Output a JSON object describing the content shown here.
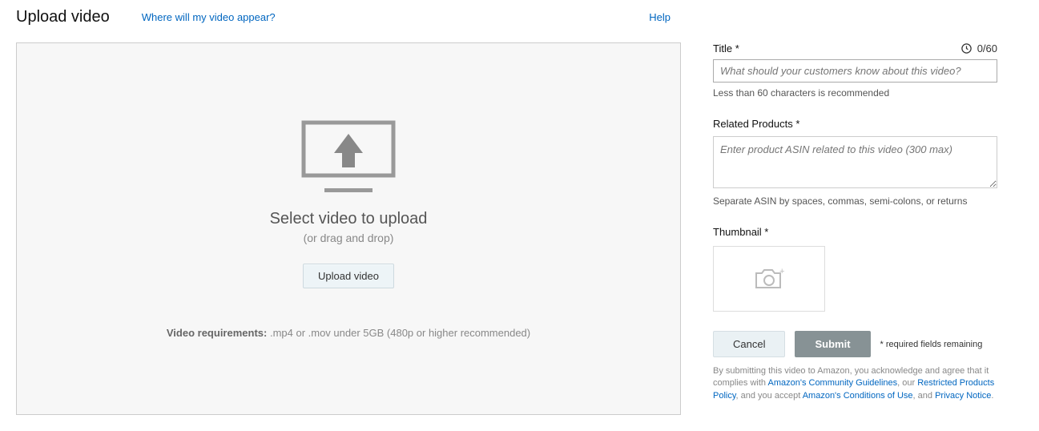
{
  "header": {
    "title": "Upload video",
    "where_link": "Where will my video appear?",
    "help": "Help"
  },
  "upload": {
    "main_text": "Select video to upload",
    "sub_text": "(or drag and drop)",
    "button": "Upload video",
    "req_label": "Video requirements:",
    "req_text": " .mp4 or .mov under 5GB (480p or higher recommended)"
  },
  "form": {
    "title_label": "Title *",
    "title_counter": "0/60",
    "title_placeholder": "What should your customers know about this video?",
    "title_hint": "Less than 60 characters is recommended",
    "related_label": "Related Products *",
    "related_placeholder": "Enter product ASIN related to this video (300 max)",
    "related_hint": "Separate ASIN by spaces, commas, semi-colons, or returns",
    "thumbnail_label": "Thumbnail *",
    "cancel": "Cancel",
    "submit": "Submit",
    "required_note": "* required fields remaining",
    "disclaimer_prefix": "By submitting this video to Amazon, you acknowledge and agree that it complies with ",
    "disclaimer_link1": "Amazon's Community Guidelines",
    "disclaimer_mid1": ", our ",
    "disclaimer_link2": "Restricted Products Policy",
    "disclaimer_mid2": ", and you accept ",
    "disclaimer_link3": "Amazon's Conditions of Use",
    "disclaimer_mid3": ", and ",
    "disclaimer_link4": "Privacy Notice",
    "disclaimer_end": "."
  }
}
